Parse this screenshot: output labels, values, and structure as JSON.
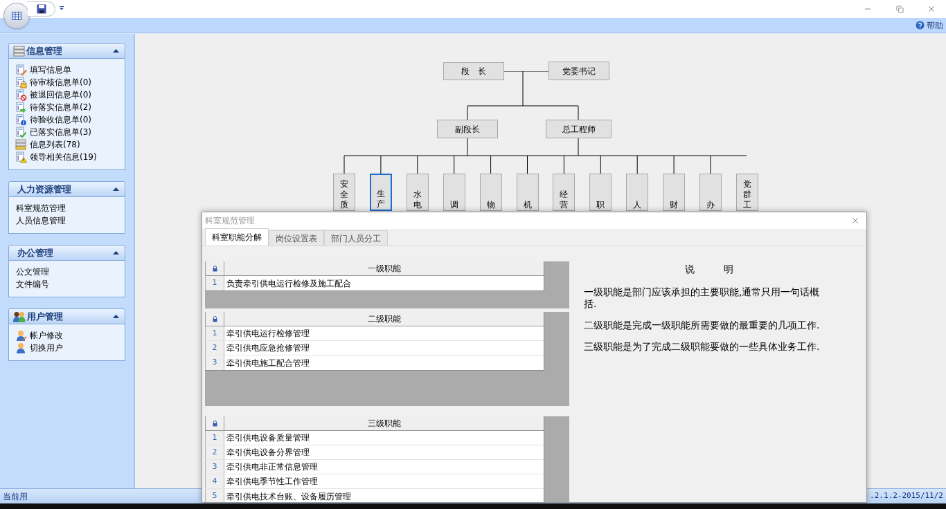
{
  "window": {
    "help": "帮助"
  },
  "sidebar": {
    "groups": [
      {
        "title": "信息管理",
        "expanded": true,
        "items": [
          "填写信息单",
          "待审核信息单(0)",
          "被退回信息单(0)",
          "待落实信息单(2)",
          "待验收信息单(0)",
          "已落实信息单(3)",
          "信息列表(78)",
          "领导相关信息(19)"
        ]
      },
      {
        "title": "人力资源管理",
        "expanded": true,
        "items": [
          "科室规范管理",
          "人员信息管理"
        ]
      },
      {
        "title": "办公管理",
        "expanded": true,
        "items": [
          "公文管理",
          "文件编号"
        ]
      },
      {
        "title": "用户管理",
        "expanded": true,
        "items": [
          "帐户修改",
          "切换用户"
        ]
      }
    ]
  },
  "org_chart": {
    "top": [
      "段　长",
      "党委书记"
    ],
    "middle": [
      "副段长",
      "总工程师"
    ],
    "departments": [
      {
        "label": "安全质",
        "selected": false
      },
      {
        "label": "生产",
        "selected": true
      },
      {
        "label": "水电",
        "selected": false
      },
      {
        "label": "调",
        "selected": false
      },
      {
        "label": "物",
        "selected": false
      },
      {
        "label": "机",
        "selected": false
      },
      {
        "label": "经营",
        "selected": false
      },
      {
        "label": "职",
        "selected": false
      },
      {
        "label": "人",
        "selected": false
      },
      {
        "label": "财",
        "selected": false
      },
      {
        "label": "办",
        "selected": false
      },
      {
        "label": "党群工",
        "selected": false
      }
    ]
  },
  "dialog": {
    "title": "科室规范管理",
    "tabs": [
      {
        "label": "科室职能分解",
        "selected": true
      },
      {
        "label": "岗位设置表",
        "selected": false
      },
      {
        "label": "部门人员分工",
        "selected": false
      }
    ],
    "grids": [
      {
        "header": "一级职能",
        "rows": [
          {
            "num": "1",
            "text": "负责牵引供电运行检修及施工配合"
          }
        ]
      },
      {
        "header": "二级职能",
        "rows": [
          {
            "num": "1",
            "text": "牵引供电运行检修管理"
          },
          {
            "num": "2",
            "text": "牵引供电应急抢修管理"
          },
          {
            "num": "3",
            "text": "牵引供电施工配合管理"
          }
        ]
      },
      {
        "header": "三级职能",
        "rows": [
          {
            "num": "1",
            "text": "牵引供电设备质量管理"
          },
          {
            "num": "2",
            "text": "牵引供电设备分界管理"
          },
          {
            "num": "3",
            "text": "牵引供电非正常信息管理"
          },
          {
            "num": "4",
            "text": "牵引供电季节性工作管理"
          },
          {
            "num": "5",
            "text": "牵引供电技术台账、设备履历管理"
          }
        ]
      }
    ],
    "notes": {
      "title": "说　　　明",
      "paragraphs": [
        "一级职能是部门应该承担的主要职能,通常只用一句话概括.",
        "二级职能是完成一级职能所需要做的最重要的几项工作.",
        "三级职能是为了完成二级职能要做的一些具体业务工作."
      ]
    }
  },
  "status_bar": {
    "user": "当前用",
    "version": ".2.1.2-2015/11/2"
  }
}
